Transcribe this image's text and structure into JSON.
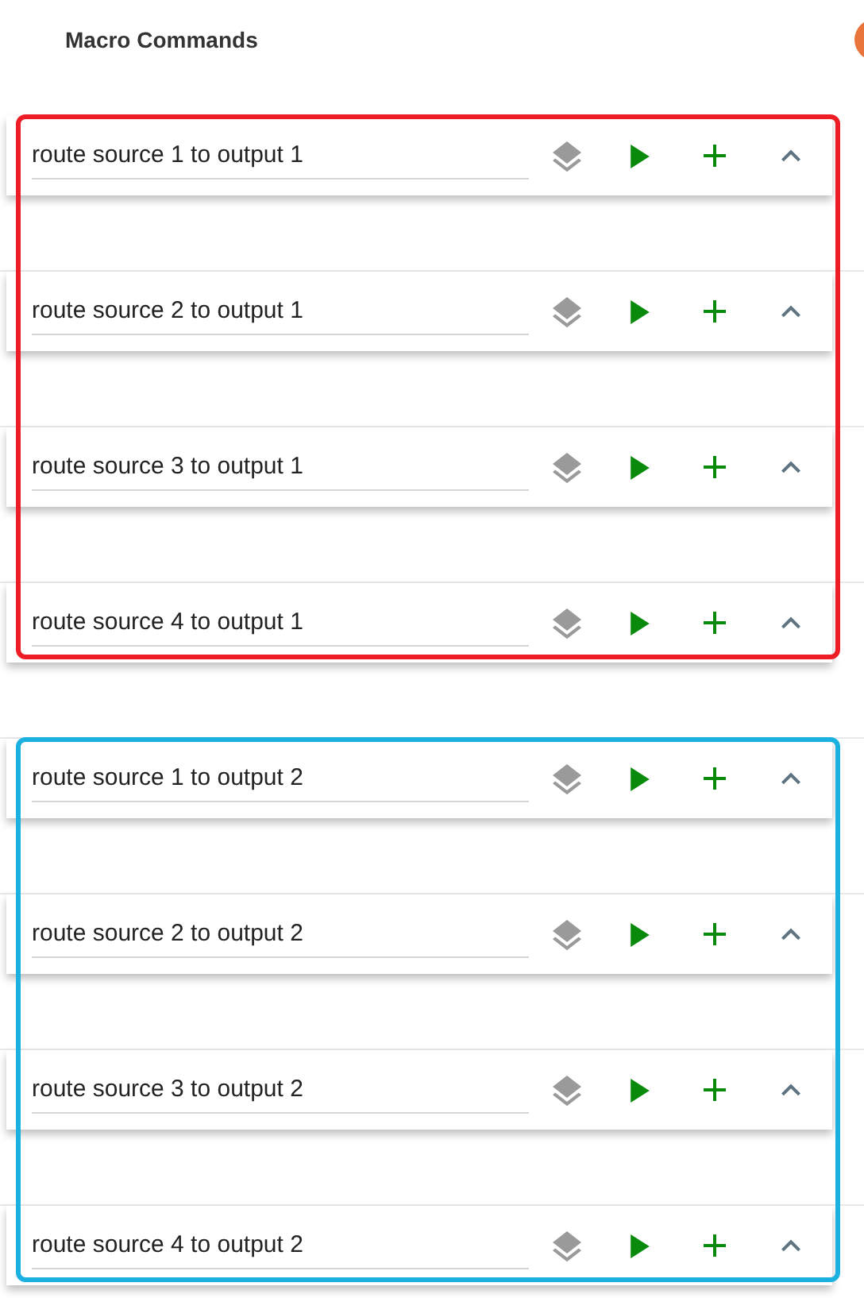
{
  "title": "Macro Commands",
  "groups": [
    {
      "color": "#ee1c25",
      "macros": [
        {
          "name": "route source 1 to output 1"
        },
        {
          "name": "route source 2 to output 1"
        },
        {
          "name": "route source 3 to output 1"
        },
        {
          "name": "route source 4 to output 1"
        }
      ]
    },
    {
      "color": "#1ab0e0",
      "macros": [
        {
          "name": "route source 1 to output 2"
        },
        {
          "name": "route source 2 to output 2"
        },
        {
          "name": "route source 3 to output 2"
        },
        {
          "name": "route source 4 to output 2"
        }
      ]
    }
  ]
}
